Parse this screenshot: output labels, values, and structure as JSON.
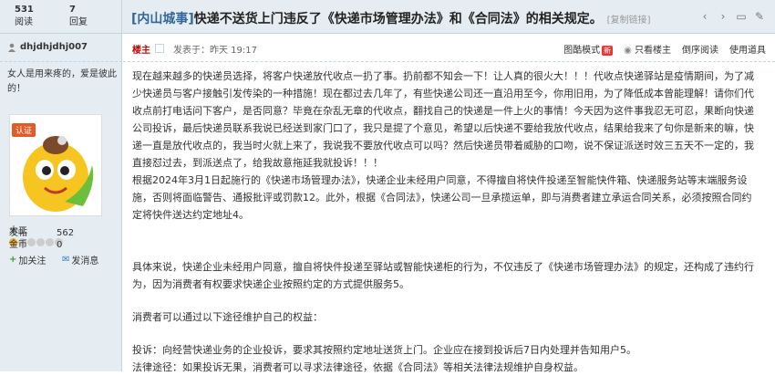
{
  "stats": {
    "views_num": "531",
    "views_label": "阅读",
    "replies_num": "7",
    "replies_label": "回复"
  },
  "thread": {
    "prefix": "[内山城事]",
    "title": "快递不送货上门违反了《快递市场管理办法》和《合同法》的相关规定。",
    "copy_link": "[复制链接]"
  },
  "author": {
    "name": "dhjdhjdhj007",
    "signature": "女人是用来疼的，爱是彼此的！",
    "badge": "认证",
    "rank": "木工",
    "posts_label": "发帖",
    "posts": "562",
    "coins_label": "金币",
    "coins": "0",
    "follow": "加关注",
    "message": "发消息"
  },
  "post": {
    "louzhu": "楼主",
    "time": "发表于：昨天 19:17",
    "tools": {
      "mode": "图酷模式",
      "new": "新",
      "only_author": "只看楼主",
      "reverse": "倒序阅读",
      "scroll": "使用道具"
    },
    "paragraphs": [
      "现在越来越多的快递员选择，将客户快递放代收点一扔了事。扔前都不知会一下！让人真的很火大！！！代收点快递驿站是疫情期间，为了减少快递员与客户接触引发传染的一种措施！现在都过去几年了，有些快递公司还一直沿用至今，你用旧用，为了降低成本曾能理解！请你们代收点前打电话问下客户，是否同意？毕竟在杂乱无章的代收点，翻找自己的快递是一件上火的事情！今天因为这件事我忍无可忍，果断向快递公司投诉，最后快递员联系我说已经送到家门口了，我只是提了个意见，希望以后快递不要给我放代收点，结果给我来了句你是新来的嘛，快递一直是放代收点的，我当时火就上来了，我说我不要放代收点可以吗？然后快递员带着威胁的口吻，说不保证派送时效三五天不一定的，我直接怼过去，到派送点了，给我故意拖延我就投诉！！！",
      "根据2024年3月1日起施行的《快递市场管理办法》，快递企业未经用户同意，不得擅自将快件投递至智能快件箱、快递服务站等末端服务设施，否则将面临警告、通报批评或罚款12。此外，根据《合同法》，快递公司一旦承揽运单，即与消费者建立承运合同关系，必须按照合同约定将快件送达约定地址4。",
      "具体来说，快递企业未经用户同意，擅自将快件投递至驿站或智能快递柜的行为，不仅违反了《快递市场管理办法》的规定，还构成了违约行为，因为消费者有权要求快递企业按照约定的方式提供服务5。",
      "消费者可以通过以下途径维护自己的权益：",
      "投诉：向经营快递业务的企业投诉，要求其按照约定地址送货上门。企业应在接到投诉后7日内处理并告知用户5。",
      "法律途径：如果投诉无果，消费者可以寻求法律途径，依据《合同法》等相关法律法规维护自身权益。"
    ]
  }
}
